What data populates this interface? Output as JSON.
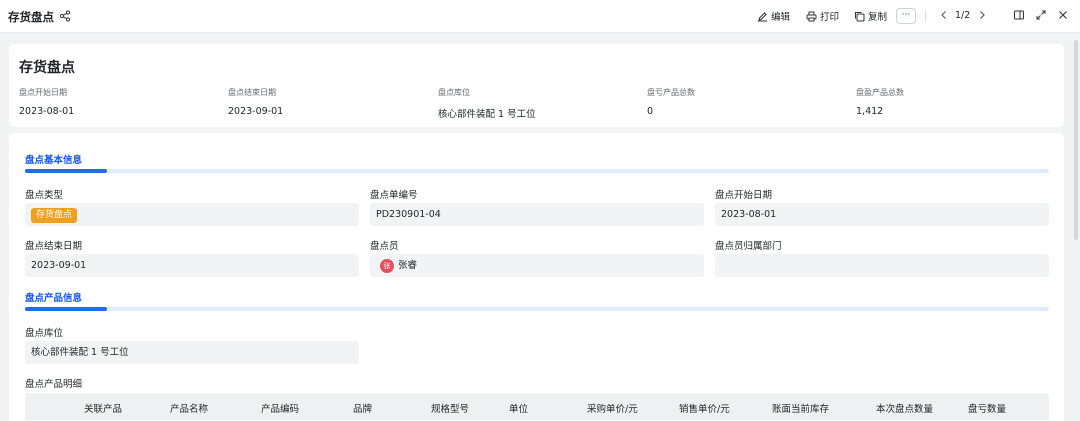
{
  "header": {
    "title": "存货盘点",
    "share_icon": "share-icon",
    "edit_label": "编辑",
    "print_label": "打印",
    "copy_label": "复制",
    "more_label": "···",
    "pager": "1/2"
  },
  "summary": {
    "title": "存货盘点",
    "fields": [
      {
        "label": "盘点开始日期",
        "value": "2023-08-01"
      },
      {
        "label": "盘点结束日期",
        "value": "2023-09-01"
      },
      {
        "label": "盘点库位",
        "value": "核心部件装配 1 号工位"
      },
      {
        "label": "盘亏产品总数",
        "value": "0"
      },
      {
        "label": "盘盈产品总数",
        "value": "1,412"
      }
    ]
  },
  "basic_section": {
    "title": "盘点基本信息",
    "type_label": "盘点类型",
    "type_tag": "存货盘点",
    "number_label": "盘点单编号",
    "number_value": "PD230901-04",
    "start_label": "盘点开始日期",
    "start_value": "2023-08-01",
    "end_label": "盘点结束日期",
    "end_value": "2023-09-01",
    "staff_label": "盘点员",
    "staff_avatar": "张",
    "staff_value": "张睿",
    "dept_label": "盘点员归属部门",
    "dept_value": ""
  },
  "product_section": {
    "title": "盘点产品信息",
    "location_label": "盘点库位",
    "location_value": "核心部件装配 1 号工位",
    "detail_label": "盘点产品明细",
    "columns": [
      "关联产品",
      "产品名称",
      "产品编码",
      "品牌",
      "规格型号",
      "单位",
      "采购单价/元",
      "销售单价/元",
      "账面当前库存",
      "本次盘点数量",
      "盘亏数量"
    ]
  },
  "colors": {
    "accent": "#1e6fe5",
    "tag_orange": "#f0a020",
    "avatar_red": "#e8505b"
  }
}
